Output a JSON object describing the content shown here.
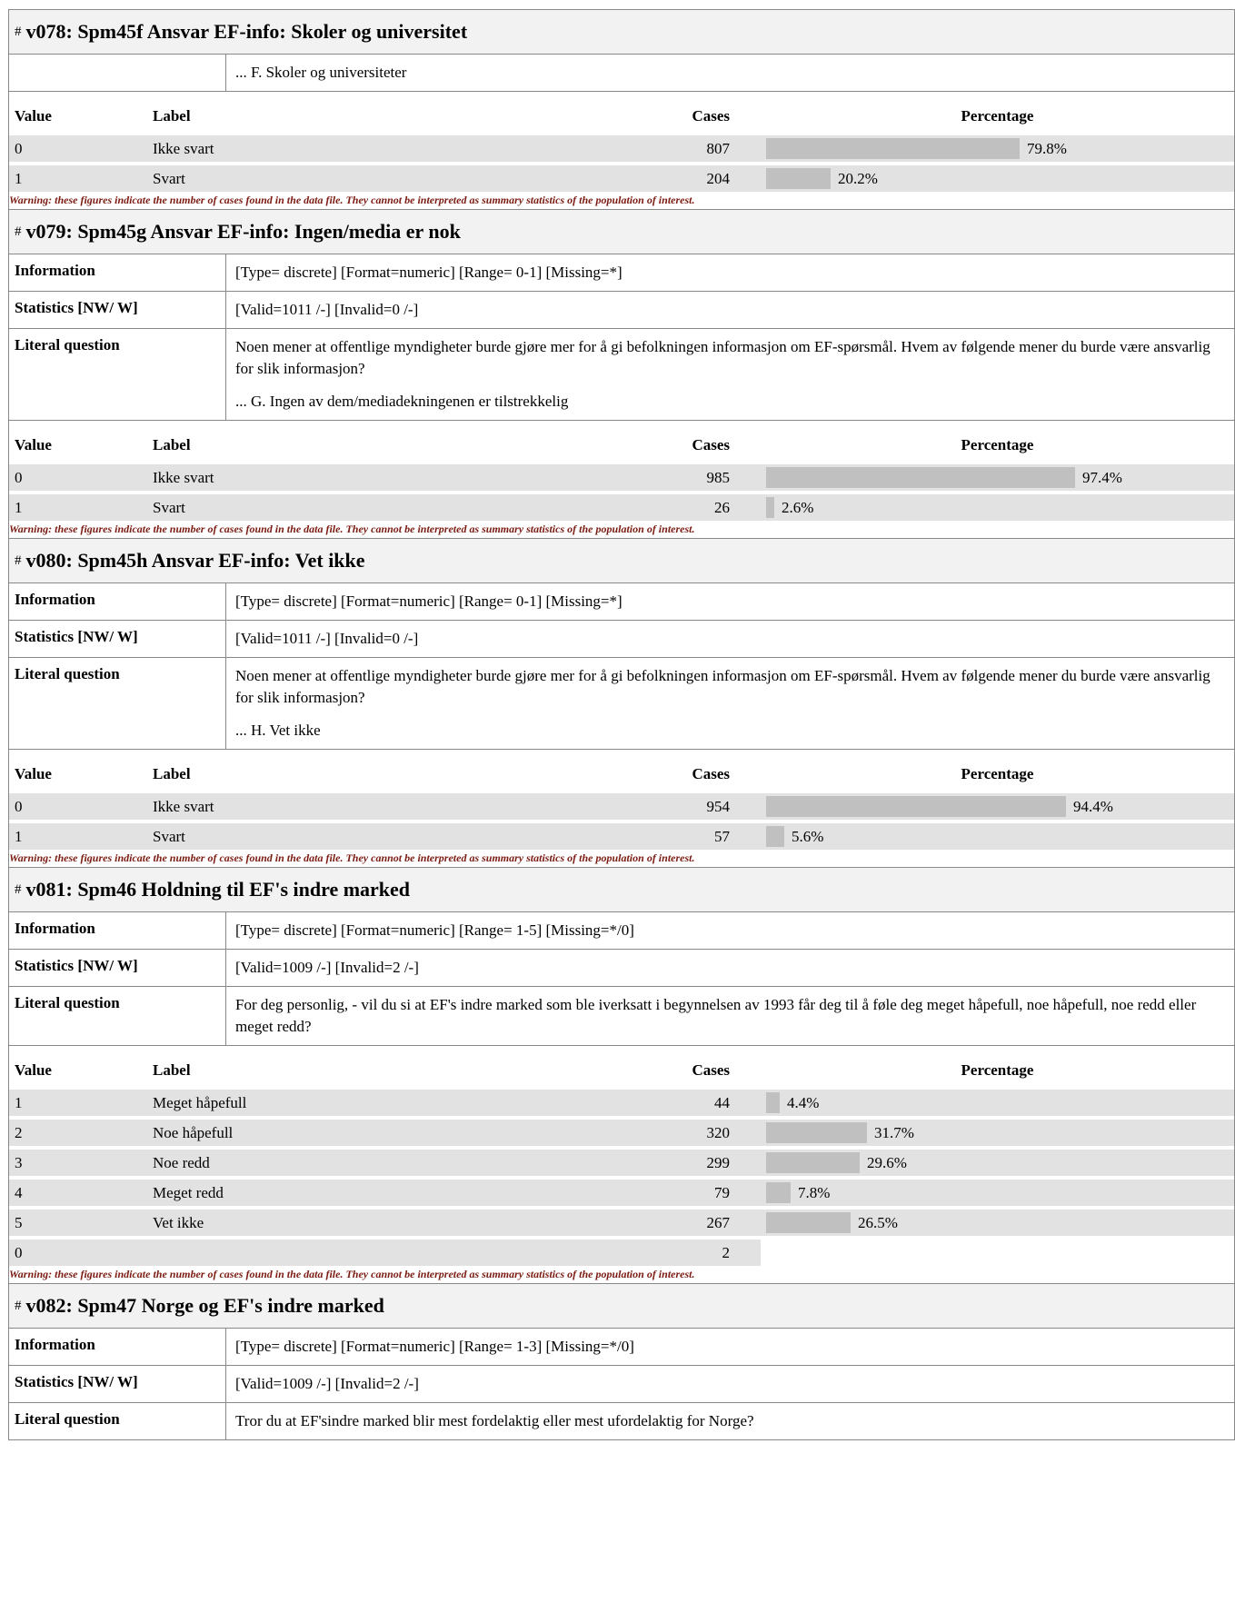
{
  "warning": "Warning: these figures indicate the number of cases found in the data file. They cannot be interpreted as summary statistics of the population of interest.",
  "columns": {
    "value": "Value",
    "label": "Label",
    "cases": "Cases",
    "percentage": "Percentage"
  },
  "row_labels": {
    "information": "Information",
    "statistics": "Statistics [NW/ W]",
    "literal": "Literal question"
  },
  "colors": {
    "bar": "#c0c0c0",
    "row_bg": "#e2e2e2",
    "header_bg": "#f2f2f2",
    "warning": "#7b1b12"
  },
  "sections": [
    {
      "id": "v078",
      "title": "v078: Spm45f Ansvar EF-info: Skoler og universitet",
      "partial": true,
      "literal_sub": "... F. Skoler og universiteter",
      "rows": [
        {
          "value": "0",
          "label": "Ikke svart",
          "cases": "807",
          "pct": 79.8,
          "pct_text": "79.8%"
        },
        {
          "value": "1",
          "label": "Svart",
          "cases": "204",
          "pct": 20.2,
          "pct_text": "20.2%"
        }
      ]
    },
    {
      "id": "v079",
      "title": "v079: Spm45g Ansvar EF-info: Ingen/media er nok",
      "information": "[Type= discrete] [Format=numeric] [Range= 0-1] [Missing=*]",
      "statistics": "[Valid=1011 /-] [Invalid=0 /-]",
      "literal_main": "Noen mener at offentlige myndigheter burde gjøre mer for å gi befolkningen informasjon om EF-spørsmål. Hvem av følgende mener du burde være ansvarlig for slik informasjon?",
      "literal_sub": "... G. Ingen av dem/mediadekningenen er tilstrekkelig",
      "rows": [
        {
          "value": "0",
          "label": "Ikke svart",
          "cases": "985",
          "pct": 97.4,
          "pct_text": "97.4%"
        },
        {
          "value": "1",
          "label": "Svart",
          "cases": "26",
          "pct": 2.6,
          "pct_text": "2.6%"
        }
      ]
    },
    {
      "id": "v080",
      "title": "v080: Spm45h Ansvar EF-info: Vet ikke",
      "information": "[Type= discrete] [Format=numeric] [Range= 0-1] [Missing=*]",
      "statistics": "[Valid=1011 /-] [Invalid=0 /-]",
      "literal_main": "Noen mener at offentlige myndigheter burde gjøre mer for å gi befolkningen informasjon om EF-spørsmål. Hvem av følgende mener du burde være ansvarlig for slik informasjon?",
      "literal_sub": "... H. Vet ikke",
      "rows": [
        {
          "value": "0",
          "label": "Ikke svart",
          "cases": "954",
          "pct": 94.4,
          "pct_text": "94.4%"
        },
        {
          "value": "1",
          "label": "Svart",
          "cases": "57",
          "pct": 5.6,
          "pct_text": "5.6%"
        }
      ]
    },
    {
      "id": "v081",
      "title": "v081: Spm46 Holdning til EF's indre marked",
      "information": "[Type= discrete] [Format=numeric] [Range= 1-5] [Missing=*/0]",
      "statistics": "[Valid=1009 /-] [Invalid=2 /-]",
      "literal_main": "For deg personlig, - vil du si at EF's indre marked som ble iverksatt i begynnelsen av 1993 får deg til å føle deg meget håpefull, noe håpefull, noe redd eller meget redd?",
      "rows": [
        {
          "value": "1",
          "label": "Meget håpefull",
          "cases": "44",
          "pct": 4.4,
          "pct_text": "4.4%"
        },
        {
          "value": "2",
          "label": "Noe håpefull",
          "cases": "320",
          "pct": 31.7,
          "pct_text": "31.7%"
        },
        {
          "value": "3",
          "label": "Noe redd",
          "cases": "299",
          "pct": 29.6,
          "pct_text": "29.6%"
        },
        {
          "value": "4",
          "label": "Meget redd",
          "cases": "79",
          "pct": 7.8,
          "pct_text": "7.8%"
        },
        {
          "value": "5",
          "label": "Vet ikke",
          "cases": "267",
          "pct": 26.5,
          "pct_text": "26.5%"
        },
        {
          "value": "0",
          "label": "",
          "cases": "2",
          "pct": null,
          "pct_text": ""
        }
      ]
    },
    {
      "id": "v082",
      "title": "v082: Spm47 Norge og EF's indre marked",
      "information": "[Type= discrete] [Format=numeric] [Range= 1-3] [Missing=*/0]",
      "statistics": "[Valid=1009 /-] [Invalid=2 /-]",
      "literal_main": "Tror du at EF'sindre marked blir mest fordelaktig eller mest ufordelaktig for Norge?",
      "rows": []
    }
  ]
}
